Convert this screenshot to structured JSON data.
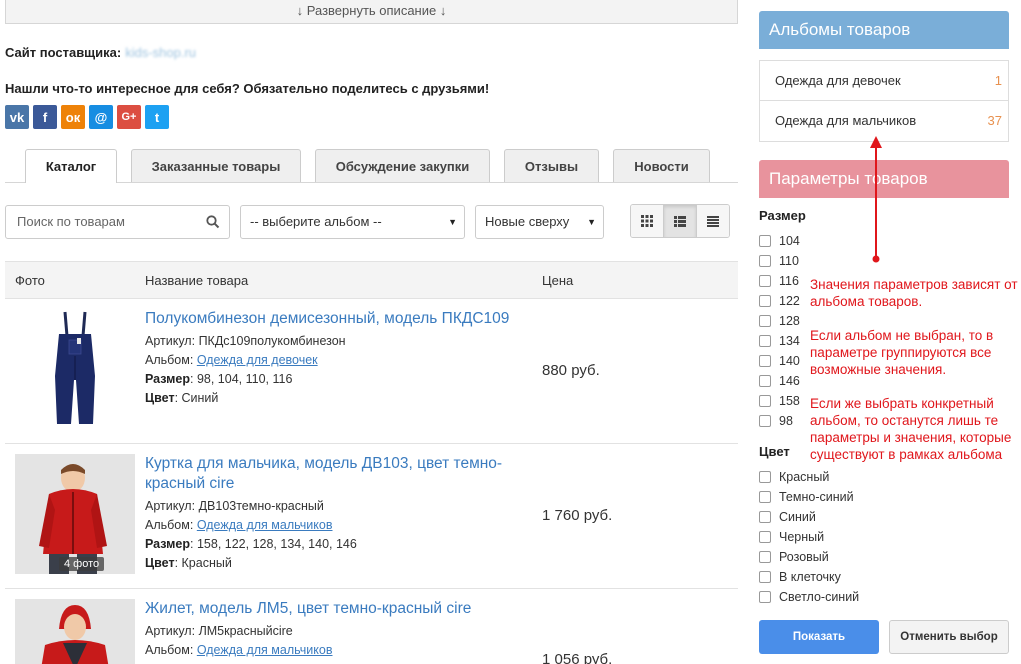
{
  "expand": {
    "label": "↓ Развернуть описание ↓"
  },
  "supplier": {
    "label": "Сайт поставщика:",
    "link": "kids-shop.ru"
  },
  "share": {
    "text": "Нашли что-то интересное для себя? Обязательно поделитесь с друзьями!"
  },
  "social": [
    {
      "name": "vk",
      "glyph": "vk",
      "color": "#4a76a8"
    },
    {
      "name": "facebook",
      "glyph": "f",
      "color": "#3b5998"
    },
    {
      "name": "odnoklassniki",
      "glyph": "ок",
      "color": "#ee8208"
    },
    {
      "name": "mailru",
      "glyph": "@",
      "color": "#168de2"
    },
    {
      "name": "googleplus",
      "glyph": "G+",
      "color": "#dc4e41"
    },
    {
      "name": "twitter",
      "glyph": "t",
      "color": "#1da1f2"
    }
  ],
  "tabs": [
    "Каталог",
    "Заказанные товары",
    "Обсуждение закупки",
    "Отзывы",
    "Новости"
  ],
  "search": {
    "placeholder": "Поиск по товарам"
  },
  "album_select": {
    "value": "-- выберите альбом --"
  },
  "sort_select": {
    "value": "Новые сверху"
  },
  "table": {
    "col_photo": "Фото",
    "col_name": "Название товара",
    "col_price": "Цена"
  },
  "products": [
    {
      "title": "Полукомбинезон демисезонный, модель ПКДС109",
      "article_label": "Артикул:",
      "article": "ПКДс109полукомбинезон",
      "album_label": "Альбом:",
      "album": "Одежда для девочек",
      "size_label": "Размер",
      "sizes": ": 98, 104, 110, 116",
      "color_label": "Цвет",
      "color": ": Синий",
      "price": "880 руб."
    },
    {
      "title": "Куртка для мальчика, модель ДВ103, цвет темно-красный cire",
      "article_label": "Артикул:",
      "article": "ДВ103темно-красный",
      "album_label": "Альбом:",
      "album": "Одежда для мальчиков",
      "size_label": "Размер",
      "sizes": ": 158, 122, 128, 134, 140, 146",
      "color_label": "Цвет",
      "color": ": Красный",
      "price": "1 760 руб.",
      "photo_badge": "4 фото"
    },
    {
      "title": "Жилет, модель ЛМ5, цвет темно-красный cire",
      "article_label": "Артикул:",
      "article": "ЛМ5красныйcire",
      "album_label": "Альбом:",
      "album": "Одежда для мальчиков",
      "price": "1 056 руб."
    }
  ],
  "sidebar": {
    "albums_title": "Альбомы товаров",
    "albums": [
      {
        "name": "Одежда для девочек",
        "count": "1"
      },
      {
        "name": "Одежда для мальчиков",
        "count": "37"
      }
    ],
    "params_title": "Параметры товаров",
    "size_title": "Размер",
    "sizes": [
      "104",
      "110",
      "116",
      "122",
      "128",
      "134",
      "140",
      "146",
      "158",
      "98"
    ],
    "color_title": "Цвет",
    "colors": [
      "Красный",
      "Темно-синий",
      "Синий",
      "Черный",
      "Розовый",
      "В клеточку",
      "Светло-синий"
    ],
    "show_button": "Показать",
    "cancel_button": "Отменить выбор"
  },
  "annotation": {
    "p1": "Значения параметров зависят от альбома товаров.",
    "p2": "Если альбом не выбран, то в параметре группируются все возможные значения.",
    "p3": "Если же выбрать конкретный альбом, то останутся лишь те параметры и значения, которые существуют в рамках альбома"
  },
  "colors": {
    "link": "#3a7bbf",
    "albums_head": "#7aaed8",
    "params_head": "#e8939d",
    "count": "#e8914f",
    "annotation": "#e0161b",
    "primary_button": "#4a8ee9"
  }
}
